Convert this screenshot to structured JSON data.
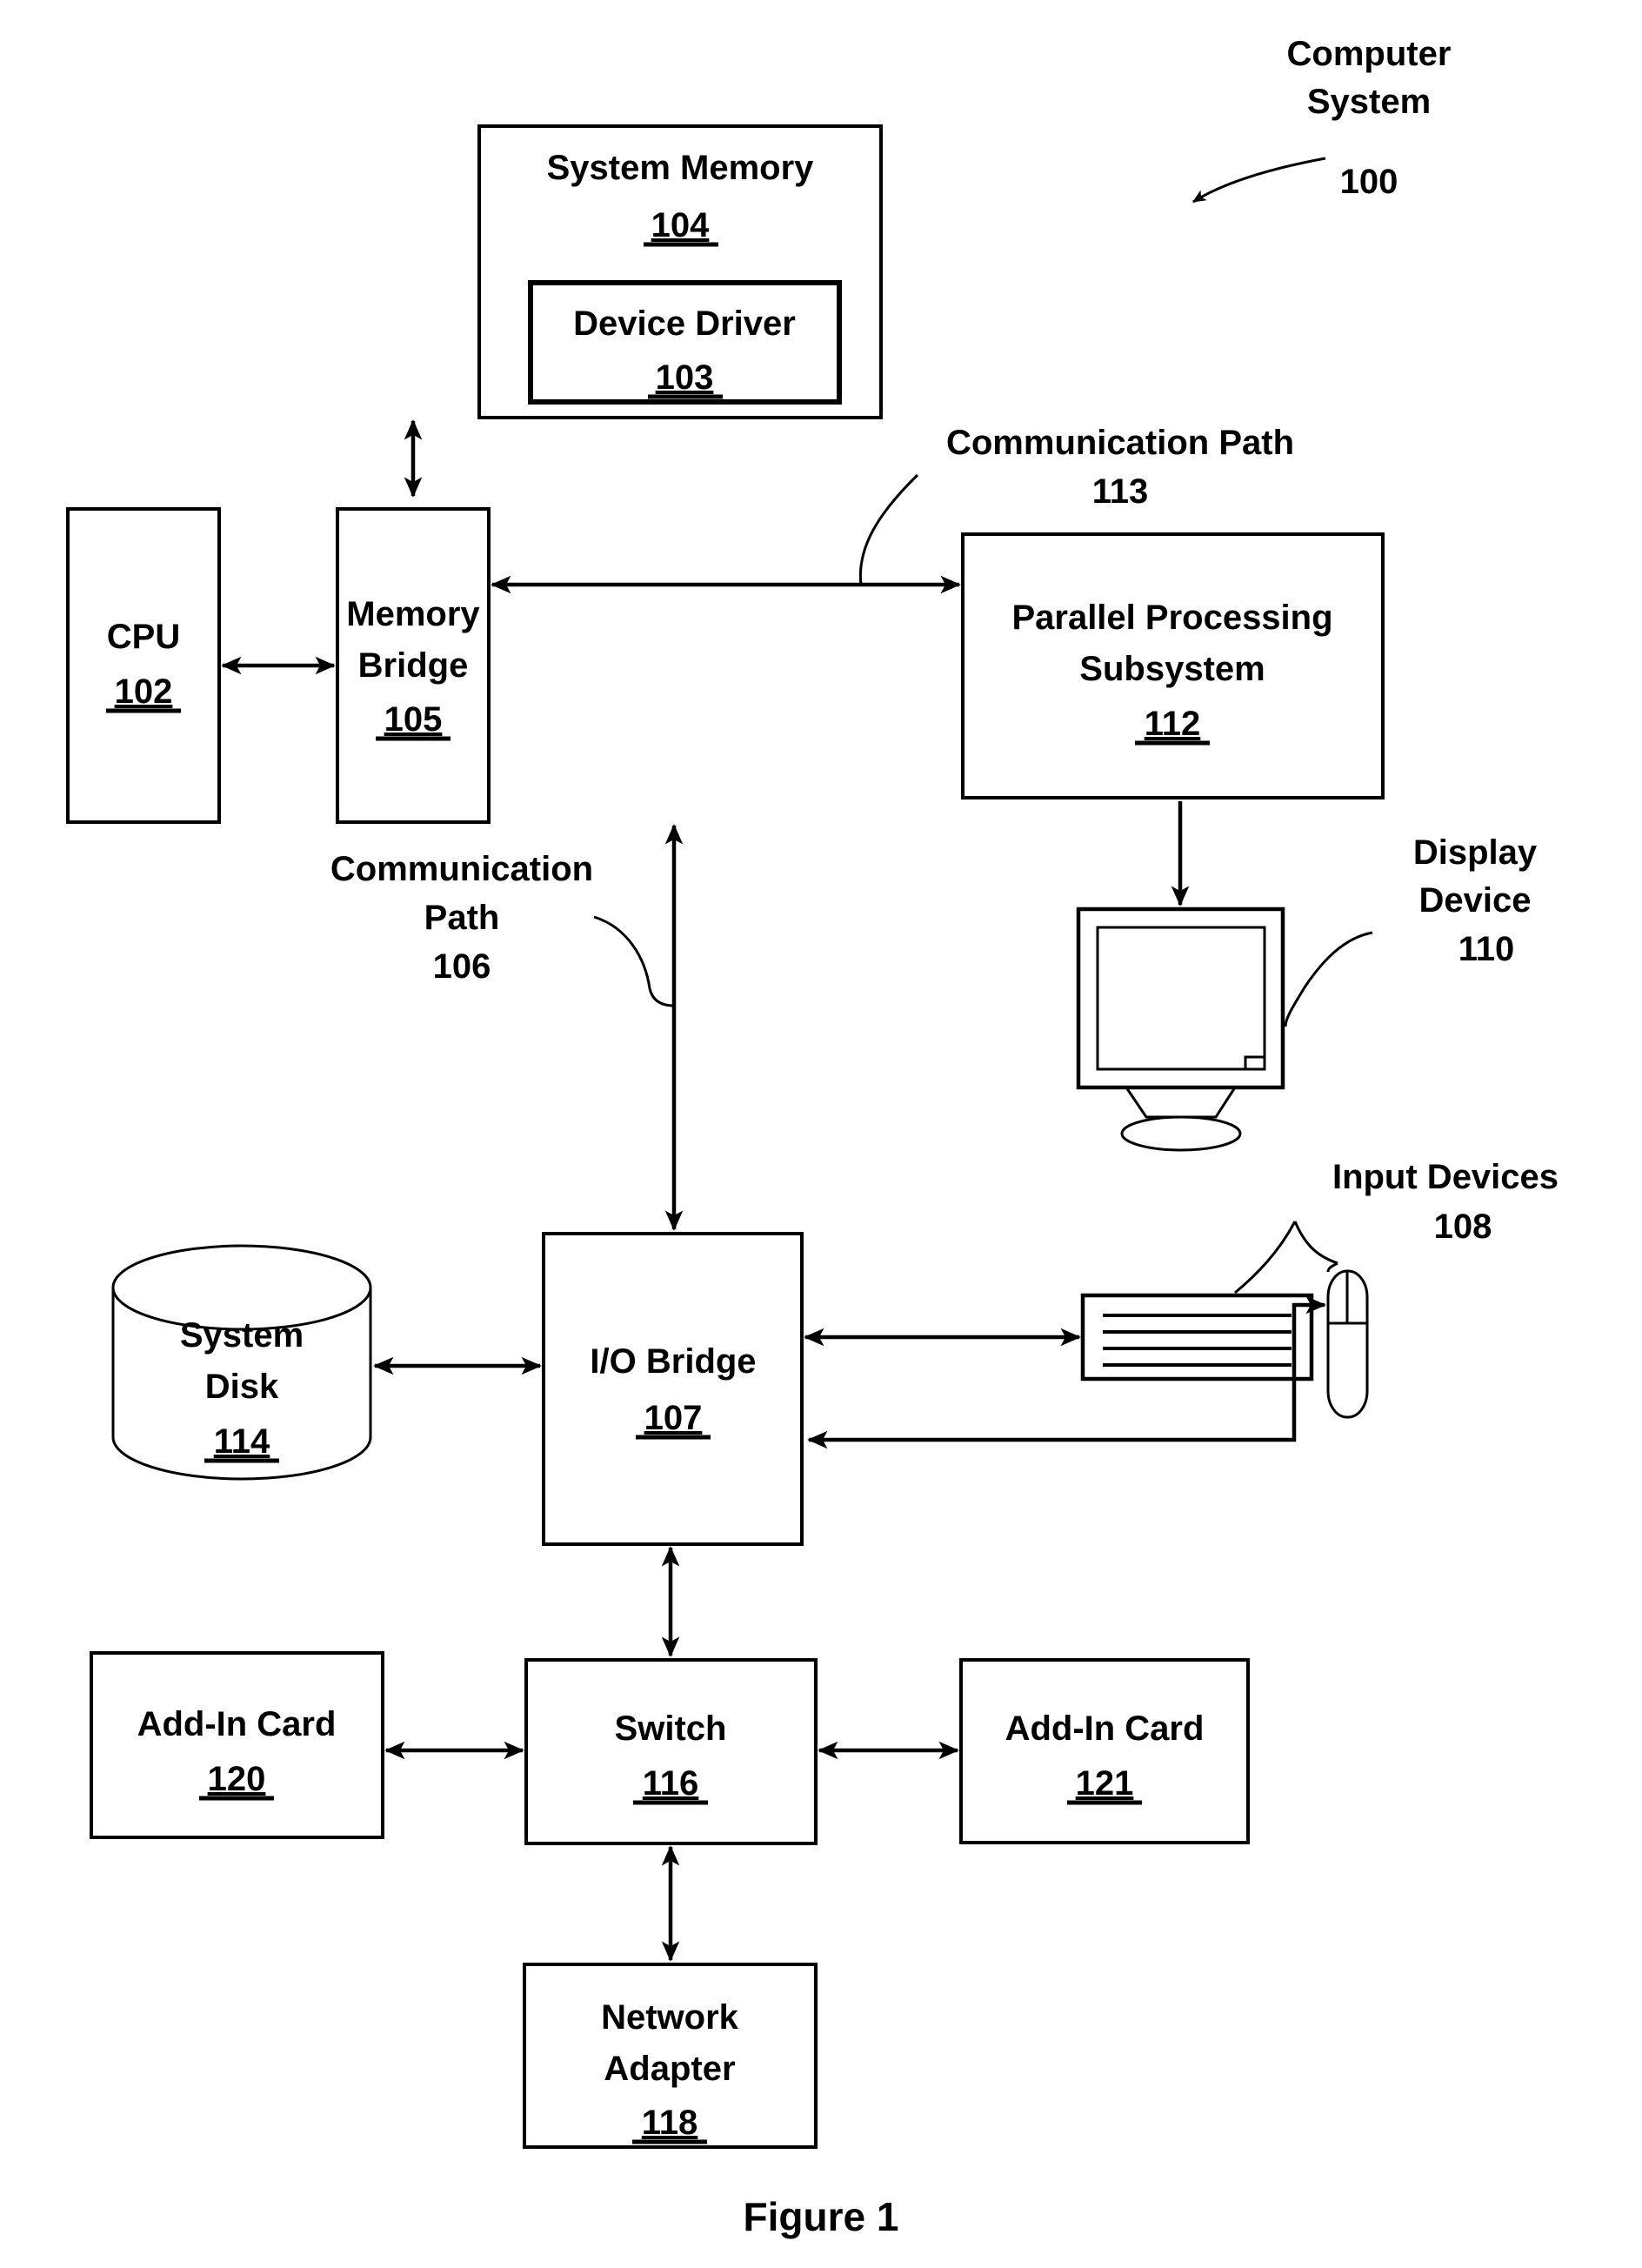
{
  "figure": {
    "caption": "Figure 1",
    "title_label": "Computer System",
    "title_ref": "100"
  },
  "blocks": {
    "system_memory": {
      "label": "System Memory",
      "ref": "104"
    },
    "device_driver": {
      "label": "Device Driver",
      "ref": "103"
    },
    "cpu": {
      "label": "CPU",
      "ref": "102"
    },
    "memory_bridge": {
      "label_line1": "Memory",
      "label_line2": "Bridge",
      "ref": "105"
    },
    "parallel_processing_subsystem": {
      "label_line1": "Parallel Processing",
      "label_line2": "Subsystem",
      "ref": "112"
    },
    "io_bridge": {
      "label": "I/O Bridge",
      "ref": "107"
    },
    "system_disk": {
      "label_line1": "System",
      "label_line2": "Disk",
      "ref": "114"
    },
    "switch": {
      "label": "Switch",
      "ref": "116"
    },
    "add_in_card_left": {
      "label": "Add-In Card",
      "ref": "120"
    },
    "add_in_card_right": {
      "label": "Add-In Card",
      "ref": "121"
    },
    "network_adapter": {
      "label_line1": "Network",
      "label_line2": "Adapter",
      "ref": "118"
    }
  },
  "callouts": {
    "communication_path_113": {
      "label_line1": "Communication Path",
      "label_line2": "",
      "ref": "113"
    },
    "communication_path_106": {
      "label_line1": "Communication",
      "label_line2": "Path",
      "ref": "106"
    },
    "display_device": {
      "label_line1": "Display",
      "label_line2": "Device",
      "ref": "110"
    },
    "input_devices": {
      "label_line1": "Input Devices",
      "label_line2": "",
      "ref": "108"
    }
  },
  "icons": {
    "monitor": "display-monitor-icon",
    "keyboard": "keyboard-icon",
    "mouse": "mouse-icon",
    "disk": "disk-cylinder-icon"
  },
  "colors": {
    "ink": "#000000",
    "paper": "#ffffff"
  }
}
